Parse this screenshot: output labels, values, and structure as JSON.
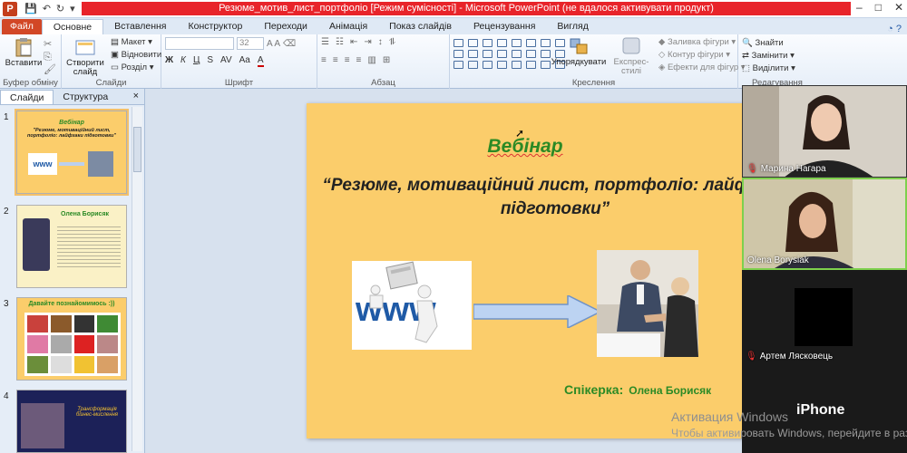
{
  "window": {
    "title": "Резюме_мотив_лист_портфоліо [Режим сумісності] - Microsoft PowerPoint (не вдалося активувати продукт)",
    "app_logo": "P"
  },
  "tabs": [
    "Файл",
    "Основне",
    "Вставлення",
    "Конструктор",
    "Переходи",
    "Анімація",
    "Показ слайдів",
    "Рецензування",
    "Вигляд"
  ],
  "ribbon": {
    "clipboard": {
      "paste": "Вставити",
      "label": "Буфер обміну"
    },
    "slides": {
      "new_slide": "Створити слайд",
      "layout": "Макет",
      "reset": "Відновити",
      "section": "Розділ",
      "label": "Слайди"
    },
    "font": {
      "size": "32",
      "label": "Шрифт"
    },
    "paragraph": {
      "label": "Абзац"
    },
    "drawing": {
      "arrange": "Упорядкувати",
      "quick_styles": "Експрес-стилі",
      "fill": "Заливка фігури",
      "outline": "Контур фігури",
      "effects": "Ефекти для фігур",
      "label": "Креслення"
    },
    "editing": {
      "find": "Знайти",
      "replace": "Замінити",
      "select": "Виділити",
      "label": "Редагування"
    }
  },
  "panel": {
    "tabs": [
      "Слайди",
      "Структура"
    ],
    "close": "×",
    "slides": [
      {
        "num": "1",
        "title": "Вебінар",
        "subtitle": "\"Резюме, мотиваційний лист, портфоліо: лайфхаки підготовки\""
      },
      {
        "num": "2",
        "title": "Олена Борисяк"
      },
      {
        "num": "3",
        "title": "Давайте познайомимось :))"
      },
      {
        "num": "4",
        "title": "Трансформація бізнес-мислення"
      }
    ]
  },
  "slide": {
    "title": "Вебінар",
    "subtitle": "“Резюме, мотиваційний лист, портфоліо: лайфхаки підготовки”",
    "speaker_label": "Спікерка:",
    "speaker_name": "Олена Борисяк"
  },
  "video": {
    "participants": [
      {
        "name": "Марина Нагара"
      },
      {
        "name": "Olena Borysiak"
      },
      {
        "name": "Артем Лясковець"
      }
    ],
    "device_label": "iPhone"
  },
  "watermark": {
    "line1": "Активация Windows",
    "line2": "Чтобы активировать Windows, перейдите в раздел \"Параметры\"."
  }
}
